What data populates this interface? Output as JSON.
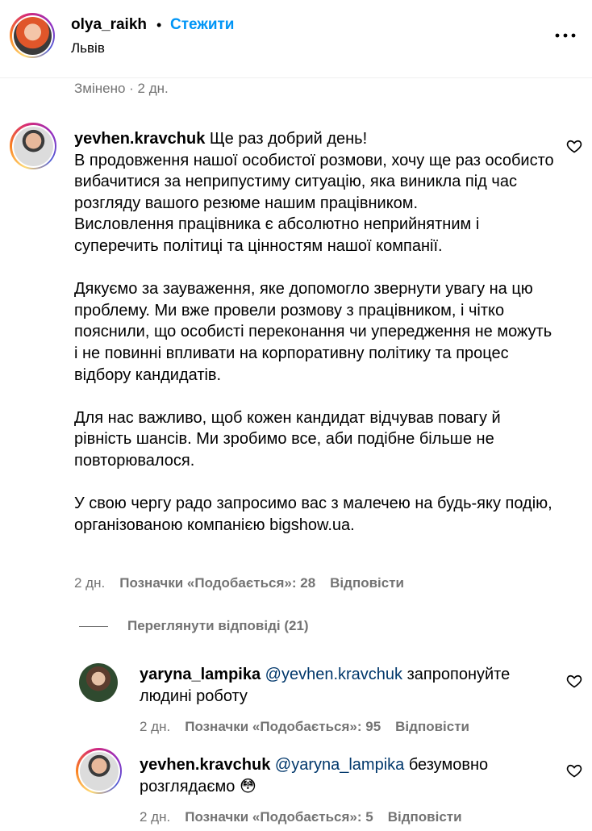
{
  "header": {
    "username": "olya_raikh",
    "dot": "•",
    "follow_label": "Стежити",
    "location": "Львів",
    "more_icon": "more-horizontal-icon"
  },
  "caption_meta": "Змінено · 2 дн.",
  "comment": {
    "username": "yevhen.kravchuk",
    "text": "Ще раз добрий день!\nВ продовження нашої особистої розмови, хочу ще раз особисто вибачитися за неприпустиму ситуацію, яка виникла під час розгляду вашого резюме нашим працівником.\nВисловлення працівника є абсолютно неприйнятним і суперечить політиці та цінностям нашої компанії.\n\nДякуємо за зауваження, яке допомогло звернути увагу на цю проблему. Ми вже провели розмову з працівником, і чітко пояснили, що особисті переконання чи упередження не можуть і не повинні впливати на корпоративну політику та процес відбору кандидатів.\n\nДля нас важливо, щоб кожен кандидат відчував повагу й рівність шансів. Ми зробимо все, аби подібне більше не повторювалося.\n\nУ свою чергу радо запросимо вас з малечею на будь-яку подію, організованою компанією bigshow.ua.",
    "time": "2 дн.",
    "likes": "Позначки «Подобається»: 28",
    "reply": "Відповісти",
    "view_replies": "Переглянути відповіді (21)"
  },
  "replies": [
    {
      "username": "yaryna_lampika",
      "mention": "@yevhen.kravchuk",
      "text": " запропонуйте людині роботу",
      "time": "2 дн.",
      "likes": "Позначки «Подобається»: 95",
      "reply": "Відповісти"
    },
    {
      "username": "yevhen.kravchuk",
      "mention": "@yaryna_lampika",
      "text": " безумовно розглядаємо ",
      "emoji": "😳",
      "time": "2 дн.",
      "likes": "Позначки «Подобається»: 5",
      "reply": "Відповісти"
    }
  ],
  "colors": {
    "text": "#000000",
    "muted": "#737373",
    "link": "#0095f6",
    "mention": "#00376b",
    "divider": "#efefef"
  }
}
